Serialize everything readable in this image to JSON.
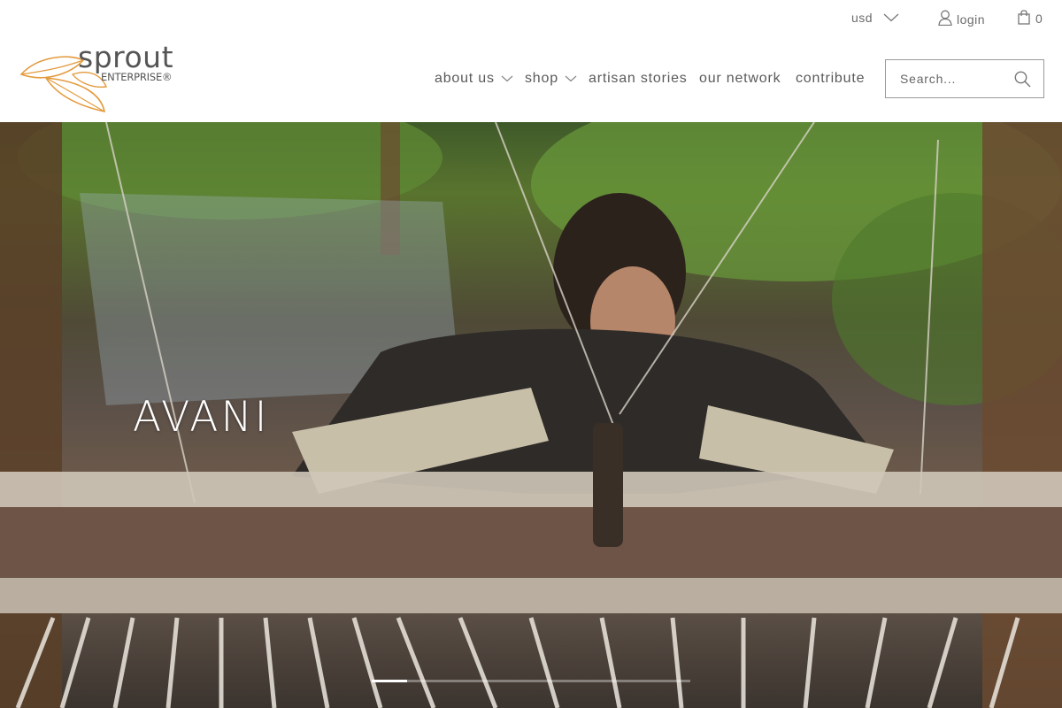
{
  "header": {
    "currency": {
      "label": "usd"
    },
    "login": {
      "label": "login"
    },
    "cart": {
      "count": "0"
    },
    "logo": {
      "word": "sprout",
      "sub": "ENTERPRISE®"
    },
    "nav": [
      {
        "label": "about us",
        "has_dropdown": true
      },
      {
        "label": "shop",
        "has_dropdown": true
      },
      {
        "label": "artisan stories",
        "has_dropdown": false
      },
      {
        "label": "our network",
        "has_dropdown": false
      },
      {
        "label": "contribute",
        "has_dropdown": false
      }
    ],
    "search": {
      "placeholder": "Search...",
      "value": ""
    }
  },
  "hero": {
    "title": "AVANI",
    "slides": 3,
    "active_slide": 1
  },
  "icons": {
    "currency_chevron": "chevron-down-icon",
    "login": "user-icon",
    "cart": "shopping-bag-icon",
    "search": "search-icon",
    "logo": "leaf-logo-icon"
  },
  "colors": {
    "text": "#5a5a5a",
    "brand_orange": "#e39a3c",
    "search_border": "#9a9a9a",
    "hero_title": "#ffffff"
  }
}
